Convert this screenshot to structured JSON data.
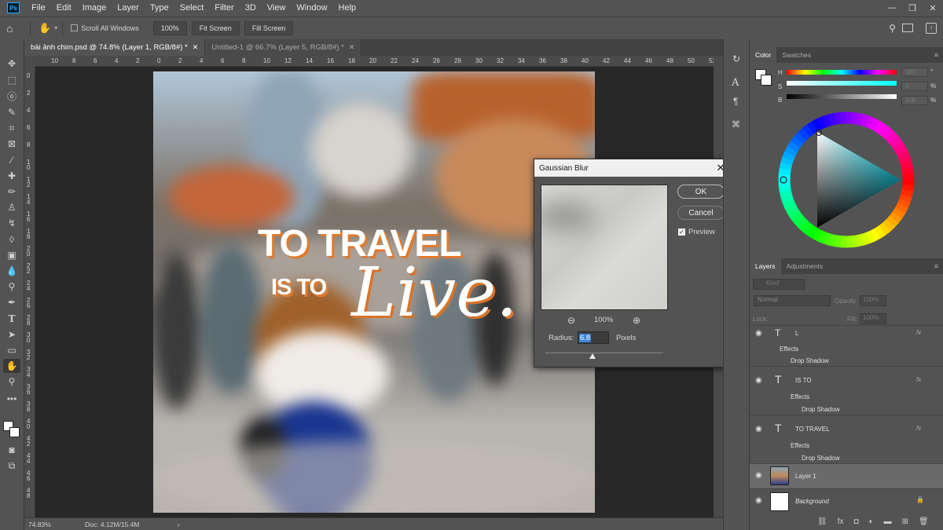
{
  "menu": [
    "File",
    "Edit",
    "Image",
    "Layer",
    "Type",
    "Select",
    "Filter",
    "3D",
    "View",
    "Window",
    "Help"
  ],
  "app_logo": "Ps",
  "options": {
    "scroll_all": "Scroll All Windows",
    "zoom": "100%",
    "fit_screen": "Fit Screen",
    "fill_screen": "Fill Screen"
  },
  "tabs": [
    {
      "label": "bài ảnh chim.psd @ 74.8% (Layer 1, RGB/8#) *"
    },
    {
      "label": "Untitled-1 @ 66.7% (Layer 5, RGB/8#) *"
    }
  ],
  "ruler_h": [
    "10",
    "8",
    "6",
    "4",
    "2",
    "0",
    "2",
    "4",
    "6",
    "8",
    "10",
    "12",
    "14",
    "16",
    "18",
    "20",
    "22",
    "24",
    "26",
    "28",
    "30",
    "32",
    "34",
    "36",
    "38",
    "40",
    "42",
    "44",
    "46",
    "48",
    "50",
    "52"
  ],
  "ruler_v": [
    "0",
    "2",
    "4",
    "6",
    "8",
    "1 0",
    "1 2",
    "1 4",
    "1 6",
    "1 8",
    "2 0",
    "2 2",
    "2 4",
    "2 6",
    "2 8",
    "3 0",
    "3 2",
    "3 4",
    "3 6",
    "3 8",
    "4 0",
    "4 2",
    "4 4",
    "4 6",
    "4 8"
  ],
  "headline": {
    "line1": "TO TRAVEL",
    "line2": "IS TO",
    "script": "Live."
  },
  "status": {
    "zoom": "74.83%",
    "doc": "Doc: 4.12M/15.4M"
  },
  "dialog": {
    "title": "Gaussian Blur",
    "ok": "OK",
    "cancel": "Cancel",
    "preview_label": "Preview",
    "preview_checked": true,
    "zoom": "100%",
    "radius_label": "Radius:",
    "radius_value": "6.8",
    "radius_unit": "Pixels",
    "radius_slider_fraction": 0.2
  },
  "color_panel": {
    "tabs": [
      "Color",
      "Swatches"
    ],
    "h_label": "H",
    "s_label": "S",
    "b_label": "B",
    "h_value": "180",
    "s_value": "0",
    "b_value": "100",
    "h_unit": "°",
    "s_unit": "%",
    "b_unit": "%"
  },
  "layers_panel": {
    "tabs": [
      "Layers",
      "Adjustments"
    ],
    "kind": "Kind",
    "blend": "Normal",
    "opacity_label": "Opacity:",
    "opacity_value": "100%",
    "lock_label": "Lock:",
    "fill_label": "Fill:",
    "fill_value": "100%",
    "layers": [
      {
        "name": "L",
        "type": "text"
      },
      {
        "name": "IS TO",
        "type": "text"
      },
      {
        "name": "TO TRAVEL",
        "type": "text"
      },
      {
        "name": "Layer 1",
        "type": "image",
        "selected": true
      },
      {
        "name": "Background",
        "type": "image",
        "locked": true
      }
    ],
    "effects_label": "Effects",
    "drop_shadow_label": "Drop Shadow"
  },
  "colors": {
    "accent": "#31a8ff",
    "shadow_orange": "#e07a2e",
    "ui_bg": "#535353",
    "canvas_bg": "#282828"
  }
}
